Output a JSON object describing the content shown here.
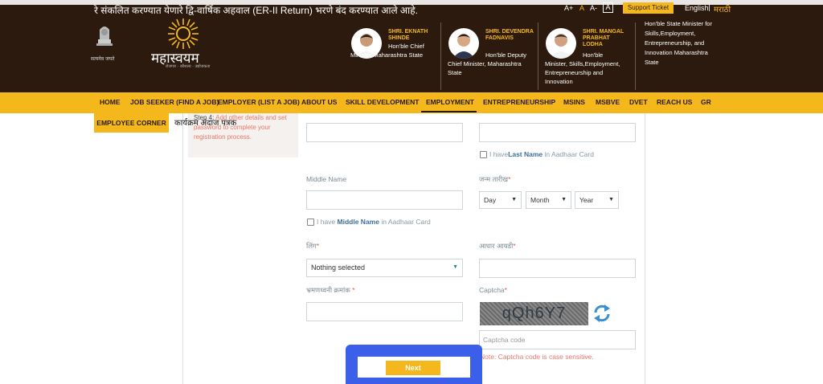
{
  "header": {
    "marquee": "रे संकलित करण्यात येणारे द्वि-वार्षिक अहवाल (ER-II Return) भरणे बंद करण्यात आले आहे.",
    "font_sizes": [
      "A+",
      "A",
      "A-",
      "A"
    ],
    "support_ticket": "Support Ticket",
    "lang_en": "English",
    "lang_sep": "|",
    "lang_mr": "मराठी",
    "emblem_caption": "सत्यमेव जयते",
    "brand": "महास्वयम",
    "brand_sub": "रोजगार · कौशल्य · उद्योजकता",
    "ministers": [
      {
        "name": "SHRI. EKNATH SHINDE",
        "title": "Hon'ble Chief Minister Maharashtra State"
      },
      {
        "name": "SHRI. DEVENDRA FADNAVIS",
        "title": "Hon'ble Deputy Chief Minister, Maharashtra State"
      },
      {
        "name": "SHRI. MANGAL PRABHAT LODHA",
        "title": "Hon'ble Minister, Skills,Employment, Entrepreneurship and Innovation"
      }
    ],
    "minister4_title": "Hon'ble State Minister for Skills,Employment, Entrepreneurship, and Innovation Maharashtra State"
  },
  "nav": {
    "items": [
      "HOME",
      "JOB SEEKER (FIND A JOB)",
      "EMPLOYER (LIST A JOB)",
      "ABOUT US",
      "SKILL DEVELOPMENT",
      "EMPLOYMENT",
      "ENTREPRENEURSHIP",
      "MSINS",
      "MSBVE",
      "DVET",
      "REACH US",
      "GR"
    ],
    "employee_corner": "EMPLOYEE CORNER"
  },
  "steps": {
    "karyakram": "कार्यक्रम अंदाज पत्रक",
    "step4_prefix": "Step 4:",
    "step4_text": "Add other details and set password to complete your registration process."
  },
  "form": {
    "last_name_check_pre": "I have",
    "last_name_check_bold": "Last Name",
    "last_name_check_post": " in Aadhaar Card",
    "middle_name_label": "Middle Name",
    "dob_label": "जन्म तारीख",
    "dob_day": "Day",
    "dob_month": "Month",
    "dob_year": "Year",
    "middle_name_check_pre": "I have ",
    "middle_name_check_bold": "Middle Name",
    "middle_name_check_post": " in Aadhaar Card",
    "gender_label": "लिंग",
    "gender_value": "Nothing selected",
    "aadhaar_label": "आधार आयडी",
    "mobile_label": "भ्रमणध्वनी क्रमांक",
    "captcha_label": "Captcha",
    "captcha_text": "qQh6Y7",
    "captcha_placeholder": "Captcha code",
    "captcha_note": "Note: Captcha code is case sensitive.",
    "required_mark": "*",
    "next": "Next"
  },
  "colors": {
    "header_bg": "#2b1a0d",
    "accent": "#f5b81c",
    "highlight": "#3b5fe8",
    "note": "#e8796a"
  }
}
